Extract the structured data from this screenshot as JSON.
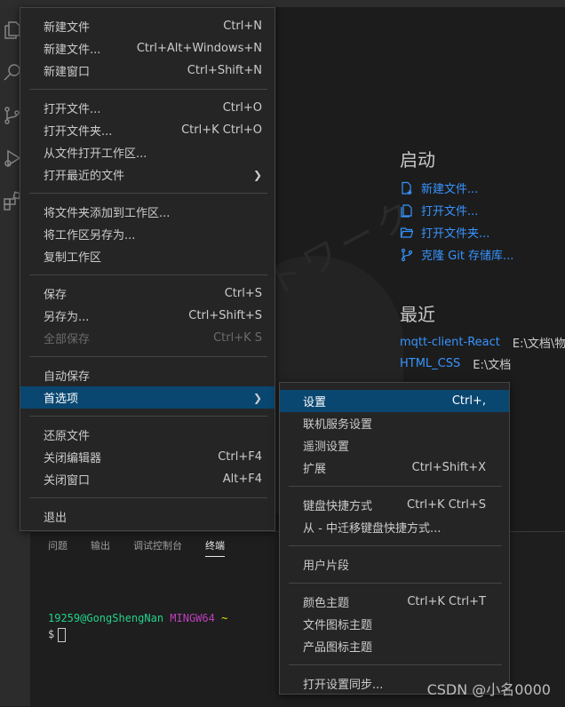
{
  "file_menu": {
    "groups": [
      [
        {
          "label": "新建文件",
          "key": "Ctrl+N"
        },
        {
          "label": "新建文件...",
          "key": "Ctrl+Alt+Windows+N"
        },
        {
          "label": "新建窗口",
          "key": "Ctrl+Shift+N"
        }
      ],
      [
        {
          "label": "打开文件...",
          "key": "Ctrl+O"
        },
        {
          "label": "打开文件夹...",
          "key": "Ctrl+K Ctrl+O"
        },
        {
          "label": "从文件打开工作区...",
          "key": ""
        },
        {
          "label": "打开最近的文件",
          "key": "",
          "submenu": true
        }
      ],
      [
        {
          "label": "将文件夹添加到工作区...",
          "key": ""
        },
        {
          "label": "将工作区另存为...",
          "key": ""
        },
        {
          "label": "复制工作区",
          "key": ""
        }
      ],
      [
        {
          "label": "保存",
          "key": "Ctrl+S"
        },
        {
          "label": "另存为...",
          "key": "Ctrl+Shift+S"
        },
        {
          "label": "全部保存",
          "key": "Ctrl+K S",
          "disabled": true
        }
      ],
      [
        {
          "label": "自动保存",
          "key": ""
        },
        {
          "label": "首选项",
          "key": "",
          "submenu": true,
          "selected": true
        }
      ],
      [
        {
          "label": "还原文件",
          "key": ""
        },
        {
          "label": "关闭编辑器",
          "key": "Ctrl+F4"
        },
        {
          "label": "关闭窗口",
          "key": "Alt+F4"
        }
      ],
      [
        {
          "label": "退出",
          "key": ""
        }
      ]
    ]
  },
  "preferences_menu": {
    "groups": [
      [
        {
          "label": "设置",
          "key": "Ctrl+,",
          "selected": true
        },
        {
          "label": "联机服务设置",
          "key": ""
        },
        {
          "label": "遥测设置",
          "key": ""
        },
        {
          "label": "扩展",
          "key": "Ctrl+Shift+X"
        }
      ],
      [
        {
          "label": "键盘快捷方式",
          "key": "Ctrl+K Ctrl+S"
        },
        {
          "label": "从 - 中迁移键盘快捷方式...",
          "key": ""
        }
      ],
      [
        {
          "label": "用户片段",
          "key": ""
        }
      ],
      [
        {
          "label": "颜色主题",
          "key": "Ctrl+K Ctrl+T"
        },
        {
          "label": "文件图标主题",
          "key": ""
        },
        {
          "label": "产品图标主题",
          "key": ""
        }
      ],
      [
        {
          "label": "打开设置同步...",
          "key": ""
        }
      ]
    ]
  },
  "welcome": {
    "start_title": "启动",
    "start_items": [
      {
        "label": "新建文件...",
        "icon": "new-file-icon"
      },
      {
        "label": "打开文件...",
        "icon": "open-file-icon"
      },
      {
        "label": "打开文件夹...",
        "icon": "open-folder-icon"
      },
      {
        "label": "克隆 Git 存储库...",
        "icon": "git-clone-icon"
      }
    ],
    "recent_title": "最近",
    "recent_items": [
      {
        "name": "mqtt-client-React",
        "path": "E:\\文档\\物联"
      },
      {
        "name": "HTML_CSS",
        "path": "E:\\文档"
      }
    ]
  },
  "panel": {
    "tabs": [
      {
        "label": "问题"
      },
      {
        "label": "输出"
      },
      {
        "label": "调试控制台"
      },
      {
        "label": "终端",
        "active": true
      }
    ],
    "terminal": {
      "user": "19259@GongShengNan",
      "host": "MINGW64",
      "cwd": "~",
      "prompt": "$"
    }
  },
  "activity_icons": [
    "explorer-icon",
    "search-icon",
    "source-control-icon",
    "run-debug-icon",
    "extensions-icon"
  ],
  "watermark_text": "ネットワーク",
  "csdn_watermark": "CSDN @小名0000",
  "colors": {
    "accent": "#094771",
    "link": "#3794ff",
    "menu_bg": "#252526"
  }
}
